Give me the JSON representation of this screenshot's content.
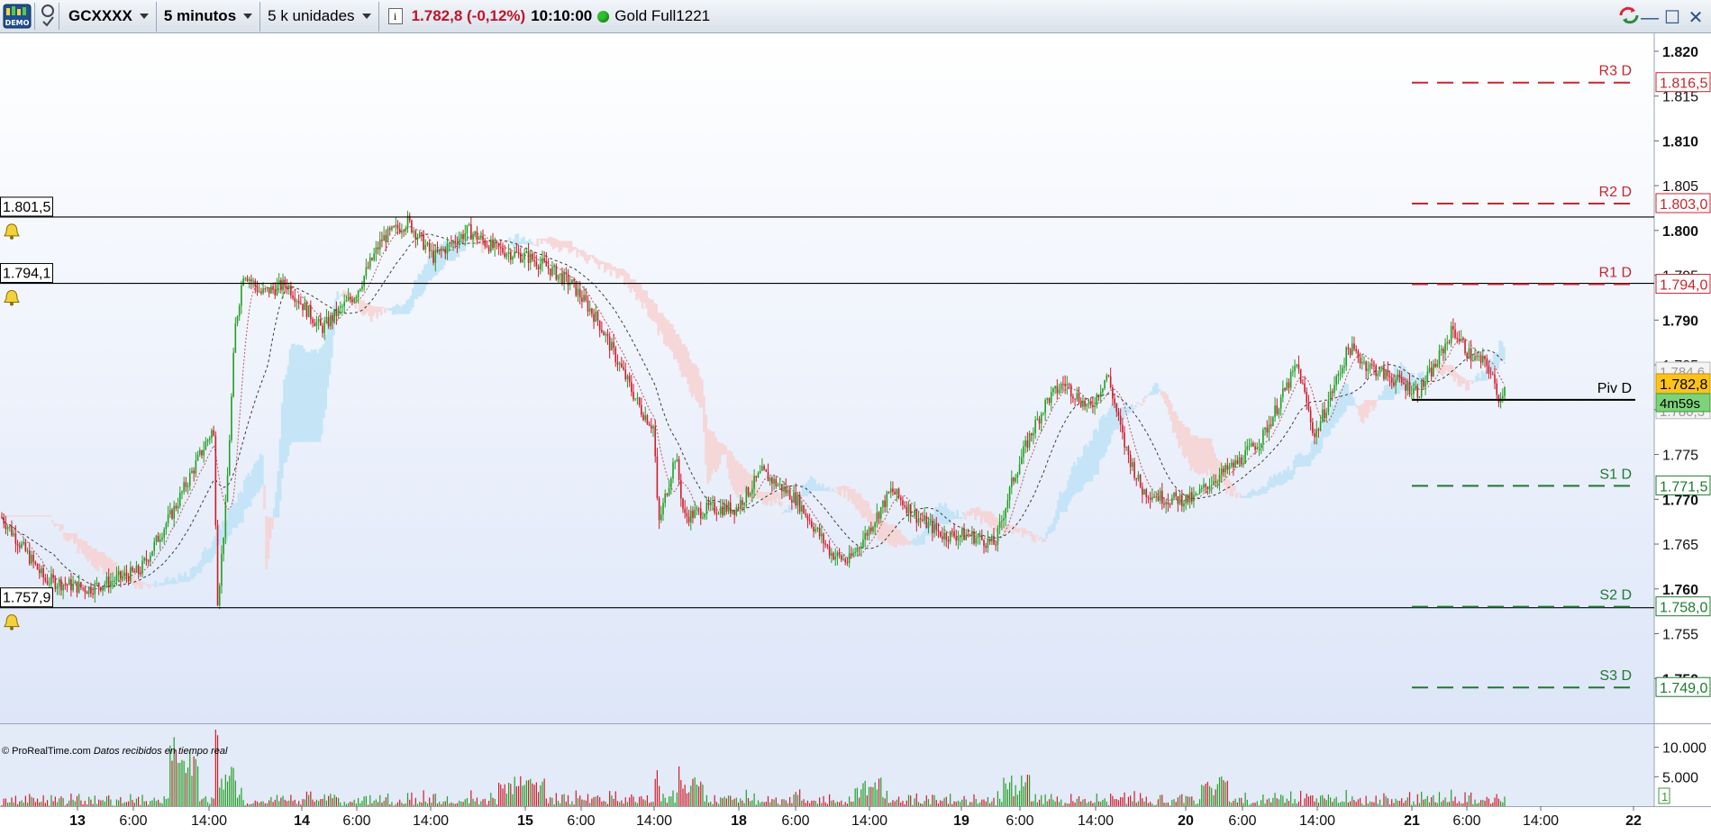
{
  "toolbar": {
    "demo_label": "DEMO",
    "instrument": "GCXXXX",
    "timeframe": "5 minutos",
    "units": "5 k unidades",
    "info_icon": "i",
    "last_price": "1.782,8 (-0,12%)",
    "clock": "10:10:00",
    "market_status_icon": "green-dot-icon",
    "contract": "Gold Full1221"
  },
  "window_buttons": {
    "sync": "sync-icon",
    "minimize": "—",
    "maximize": "☐",
    "close": "✕"
  },
  "footer": {
    "copyright": "© ProRealTime.com",
    "realtime": "Datos recibidos en tiempo real"
  },
  "colors": {
    "up": "#22a022",
    "down": "#d01c2a",
    "cloud_up": "#bfe3f7",
    "cloud_down": "#f7d3d3",
    "pivot_red": "#c8262e",
    "pivot_green": "#1d7a2e"
  },
  "chart_data": {
    "type": "candlestick",
    "symbol": "GCXXXX",
    "ylim": [
      1745,
      1822
    ],
    "y_ticks": [
      "1.820",
      "1.815",
      "1.810",
      "1.805",
      "1.800",
      "1.795",
      "1.790",
      "1.785",
      "1.780",
      "1.775",
      "1.770",
      "1.765",
      "1.760",
      "1.755",
      "1.750"
    ],
    "x_labels": [
      "13",
      "6:00",
      "14:00",
      "14",
      "6:00",
      "14:00",
      "15",
      "6:00",
      "14:00",
      "18",
      "6:00",
      "14:00",
      "19",
      "6:00",
      "14:00",
      "20",
      "6:00",
      "14:00",
      "21",
      "6:00",
      "14:00",
      "22"
    ],
    "bold_x_labels": [
      "13",
      "14",
      "15",
      "18",
      "19",
      "20",
      "21",
      "22"
    ],
    "current_price": {
      "label": "1.782,8",
      "value": 1782.8,
      "countdown": "4m59s"
    },
    "hidden_axis_tags": [
      "1.784,6",
      "1.780,3"
    ],
    "alert_lines": [
      {
        "label": "1.801,5",
        "value": 1801.5
      },
      {
        "label": "1.794,1",
        "value": 1794.1
      },
      {
        "label": "1.757,9",
        "value": 1757.9
      }
    ],
    "pivots": [
      {
        "name": "R3 D",
        "value": 1816.5,
        "label": "1.816,5",
        "kind": "resistance"
      },
      {
        "name": "R2 D",
        "value": 1803.0,
        "label": "1.803,0",
        "kind": "resistance"
      },
      {
        "name": "R1 D",
        "value": 1794.0,
        "label": "1.794,0",
        "kind": "resistance"
      },
      {
        "name": "Piv D",
        "value": 1781.1,
        "label": "",
        "kind": "pivot"
      },
      {
        "name": "S1 D",
        "value": 1771.5,
        "label": "1.771,5",
        "kind": "support"
      },
      {
        "name": "S2 D",
        "value": 1758.0,
        "label": "1.758,0",
        "kind": "support"
      },
      {
        "name": "S3 D",
        "value": 1749.0,
        "label": "1.749,0",
        "kind": "support"
      }
    ],
    "price_path_keypoints": [
      [
        0,
        1768
      ],
      [
        5,
        1761
      ],
      [
        10,
        1760
      ],
      [
        16,
        1762
      ],
      [
        20,
        1769
      ],
      [
        23,
        1775
      ],
      [
        24.5,
        1778
      ],
      [
        25,
        1758.5
      ],
      [
        26,
        1770
      ],
      [
        27,
        1789
      ],
      [
        28,
        1795.5
      ],
      [
        30,
        1793
      ],
      [
        33,
        1794
      ],
      [
        37,
        1789
      ],
      [
        41,
        1793
      ],
      [
        44,
        1799
      ],
      [
        47,
        1801
      ],
      [
        50,
        1797
      ],
      [
        54,
        1800
      ],
      [
        57,
        1798
      ],
      [
        61,
        1797
      ],
      [
        63,
        1796
      ],
      [
        66,
        1794
      ],
      [
        69,
        1790
      ],
      [
        72,
        1784
      ],
      [
        74,
        1780
      ],
      [
        75.5,
        1778
      ],
      [
        76,
        1767
      ],
      [
        78,
        1775
      ],
      [
        79,
        1768
      ],
      [
        82,
        1769
      ],
      [
        85,
        1769
      ],
      [
        88,
        1773
      ],
      [
        92,
        1770
      ],
      [
        94,
        1767
      ],
      [
        96,
        1764
      ],
      [
        98,
        1763
      ],
      [
        100,
        1766
      ],
      [
        103,
        1771
      ],
      [
        106,
        1768
      ],
      [
        109,
        1766
      ],
      [
        112,
        1766
      ],
      [
        115,
        1765
      ],
      [
        117,
        1772
      ],
      [
        119,
        1777
      ],
      [
        121,
        1781
      ],
      [
        123,
        1783
      ],
      [
        126,
        1780
      ],
      [
        128,
        1784
      ],
      [
        130,
        1776
      ],
      [
        132,
        1771
      ],
      [
        135,
        1770
      ],
      [
        138,
        1770
      ],
      [
        140,
        1772
      ],
      [
        143,
        1774
      ],
      [
        146,
        1777
      ],
      [
        148,
        1781
      ],
      [
        150,
        1785
      ],
      [
        152,
        1777
      ],
      [
        154,
        1782
      ],
      [
        156,
        1787
      ],
      [
        158,
        1785
      ],
      [
        160,
        1784
      ],
      [
        162,
        1783
      ],
      [
        164,
        1782
      ],
      [
        166,
        1785
      ],
      [
        168,
        1789
      ],
      [
        170,
        1786
      ],
      [
        172,
        1785
      ],
      [
        173.5,
        1781
      ],
      [
        174,
        1783
      ]
    ],
    "volume": {
      "y_ticks": [
        "10.000",
        "5.000"
      ],
      "ylim": [
        0,
        13000
      ],
      "current": "1"
    }
  }
}
